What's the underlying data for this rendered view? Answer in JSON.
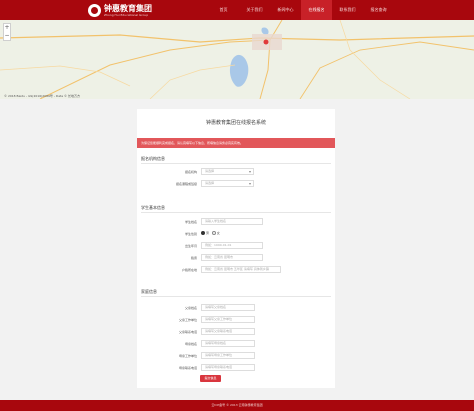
{
  "header": {
    "logo_cn": "钟惠教育集团",
    "logo_en": "Zhong Hui Educational Group",
    "nav": [
      "首页",
      "关于我们",
      "新闻中心",
      "在线报名",
      "联系我们",
      "报名查询"
    ],
    "active_index": 3
  },
  "map": {
    "footer": "© 2018 Baidu - GS(2016)2089号 - Data © 长地万方",
    "zoom_in": "+",
    "zoom_out": "−",
    "marker_label": "钟惠教育集团"
  },
  "form": {
    "title": "钟惠教育集团在线报名系统",
    "notice": "为保证您能顺利完成报名，请认真填写以下信息，所填信息请务必真实有效。",
    "section1": "报名机构信息",
    "org_label": "报名机构",
    "org_value": "请选择",
    "course_label": "报名课程或班级",
    "course_value": "请选择",
    "section2": "学生基本信息",
    "name_label": "学生姓名",
    "name_placeholder": "请输入学生姓名",
    "gender_label": "学生性别",
    "gender_male": "男",
    "gender_female": "女",
    "birth_label": "出生年月",
    "birth_placeholder": "例如：1990-01-01",
    "ethnic_label": "籍贯",
    "ethnic_placeholder": "例如：云南省 昆明市",
    "household_label": "户籍所在地",
    "household_placeholder": "例如：云南省 昆明市 五华区 请填写 具体到乡镇",
    "section3": "家庭信息",
    "father_label": "父亲姓名",
    "father_placeholder": "请填写父亲姓名",
    "father_work_label": "父亲工作单位",
    "father_work_placeholder": "请填写父亲工作单位",
    "father_phone_label": "父亲联系电话",
    "father_phone_placeholder": "请填写父亲联系电话",
    "mother_label": "母亲姓名",
    "mother_placeholder": "请填写母亲姓名",
    "mother_work_label": "母亲工作单位",
    "mother_work_placeholder": "请填写母亲工作单位",
    "mother_phone_label": "母亲联系电话",
    "mother_phone_placeholder": "请填写母亲联系电话",
    "submit": "提交信息"
  },
  "footer": {
    "text": "云ICP备号 © 2013 云南钟惠教育集团"
  },
  "colors": {
    "brand": "#a8070d",
    "accent": "#d9363e",
    "notice_bg": "#e2575a"
  }
}
